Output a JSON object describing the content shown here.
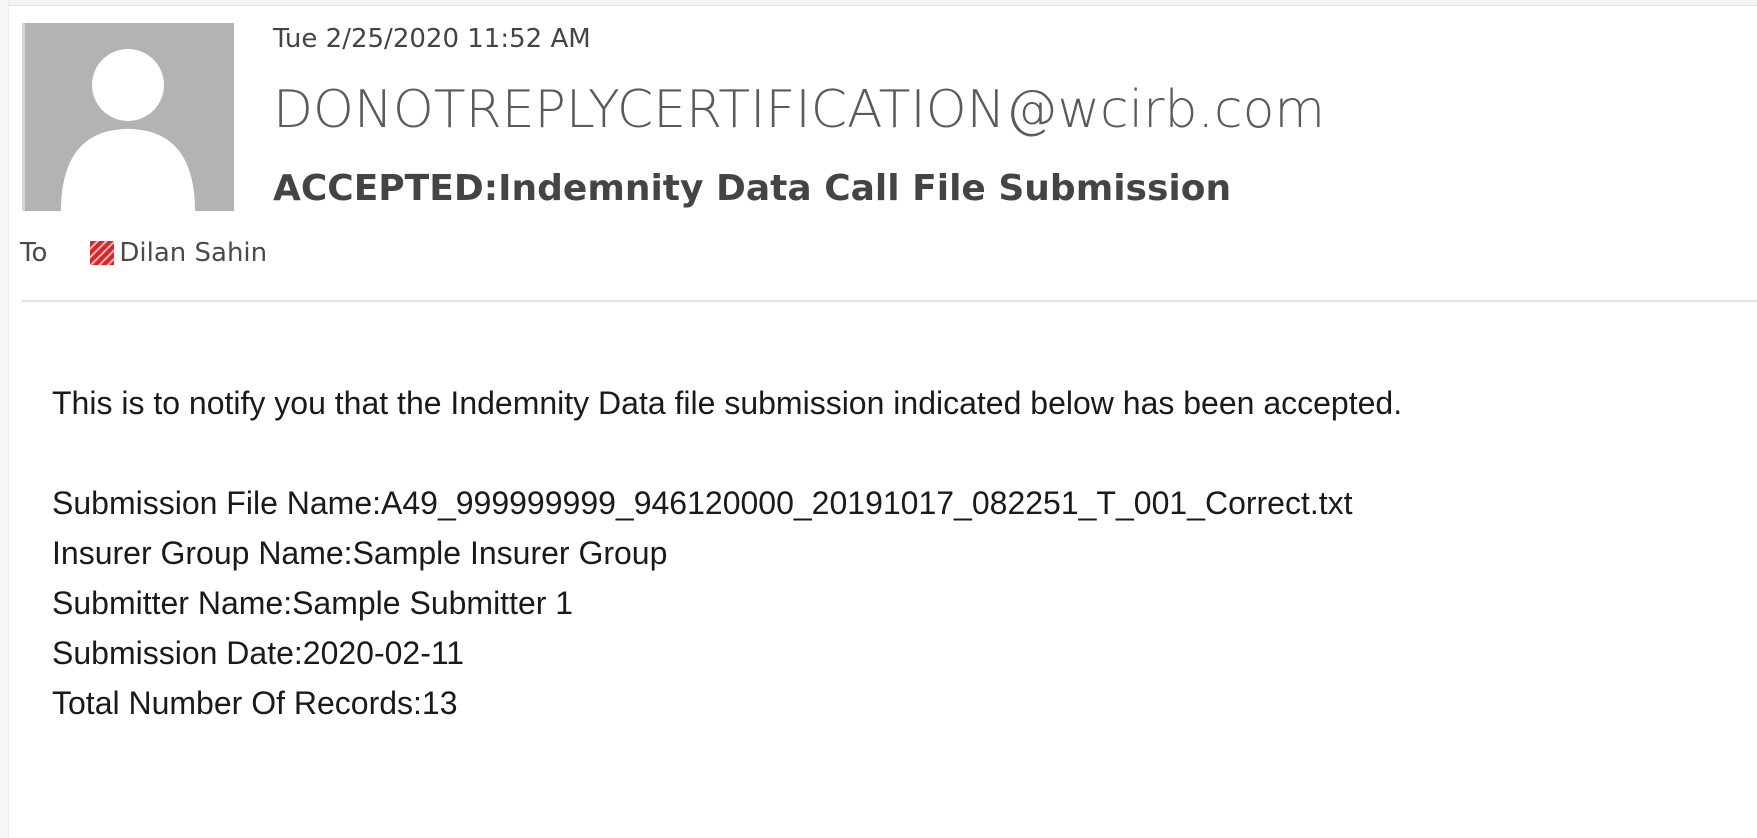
{
  "message": {
    "timestamp": "Tue 2/25/2020 11:52 AM",
    "sender": "DONOTREPLYCERTIFICATION@wcirb.com",
    "subject": "ACCEPTED:Indemnity Data Call File Submission",
    "to_label": "To",
    "recipient": "Dilan Sahin",
    "presence_icon": "presence-busy-striped-icon",
    "presence_color": "#d9262b"
  },
  "body": {
    "intro": "This is to notify you that the Indemnity Data file submission indicated below has been accepted.",
    "lines": [
      "Submission File Name:A49_999999999_946120000_20191017_082251_T_001_Correct.txt",
      "Insurer Group Name:Sample Insurer Group",
      "Submitter Name:Sample Submitter 1",
      "Submission Date:2020-02-11",
      "Total Number Of Records:13"
    ]
  },
  "colors": {
    "avatar_bg": "#b3b3b3",
    "avatar_silhouette": "#ffffff",
    "divider": "#e2e2e2"
  }
}
